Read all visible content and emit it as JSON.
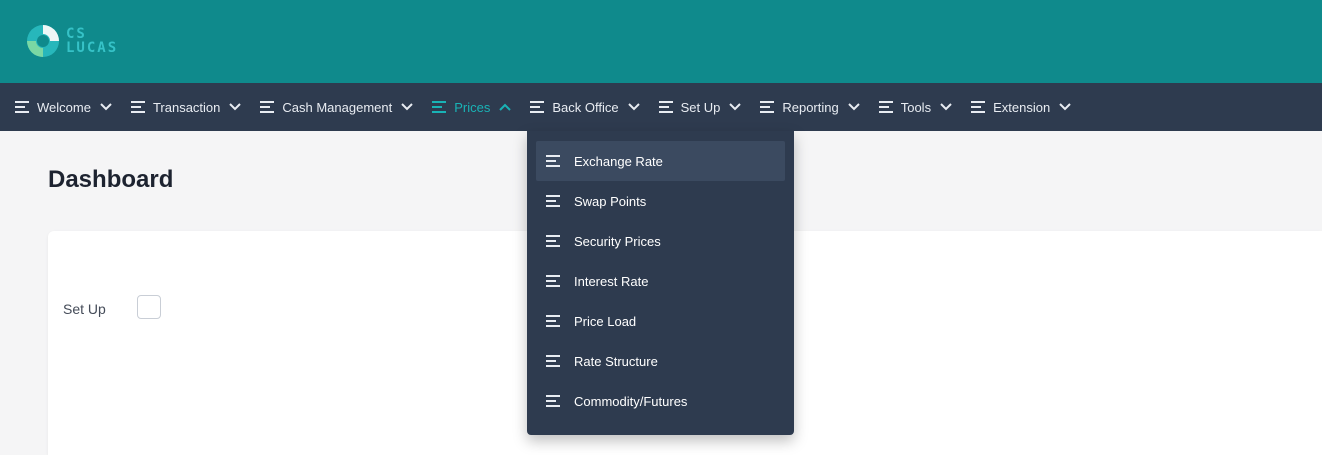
{
  "logo": {
    "line1": "CS",
    "line2": "LUCAS",
    "accent_color": "#36c2c7"
  },
  "nav": {
    "items": [
      {
        "label": "Welcome",
        "icon": "menu-lines-icon",
        "chevron": "chevron-down-icon"
      },
      {
        "label": "Transaction",
        "icon": "menu-lines-icon",
        "chevron": "chevron-down-icon"
      },
      {
        "label": "Cash Management",
        "icon": "menu-lines-icon",
        "chevron": "chevron-down-icon"
      },
      {
        "label": "Prices",
        "icon": "menu-lines-icon",
        "chevron": "chevron-up-icon",
        "active": true
      },
      {
        "label": "Back Office",
        "icon": "menu-lines-icon",
        "chevron": "chevron-down-icon"
      },
      {
        "label": "Set Up",
        "icon": "menu-lines-icon",
        "chevron": "chevron-down-icon"
      },
      {
        "label": "Reporting",
        "icon": "menu-lines-icon",
        "chevron": "chevron-down-icon"
      },
      {
        "label": "Tools",
        "icon": "menu-lines-icon",
        "chevron": "chevron-down-icon"
      },
      {
        "label": "Extension",
        "icon": "menu-lines-icon",
        "chevron": "chevron-down-icon"
      }
    ],
    "active_color": "#19b3b6"
  },
  "prices_menu": {
    "items": [
      {
        "label": "Exchange Rate",
        "highlighted": true
      },
      {
        "label": "Swap Points"
      },
      {
        "label": "Security Prices"
      },
      {
        "label": "Interest Rate"
      },
      {
        "label": "Price Load"
      },
      {
        "label": "Rate Structure"
      },
      {
        "label": "Commodity/Futures"
      }
    ]
  },
  "page": {
    "title": "Dashboard",
    "setup_label": "Set Up",
    "setup_checked": false
  },
  "colors": {
    "header": "#0f8a8c",
    "nav": "#2e3b4f",
    "background": "#f5f5f6"
  }
}
